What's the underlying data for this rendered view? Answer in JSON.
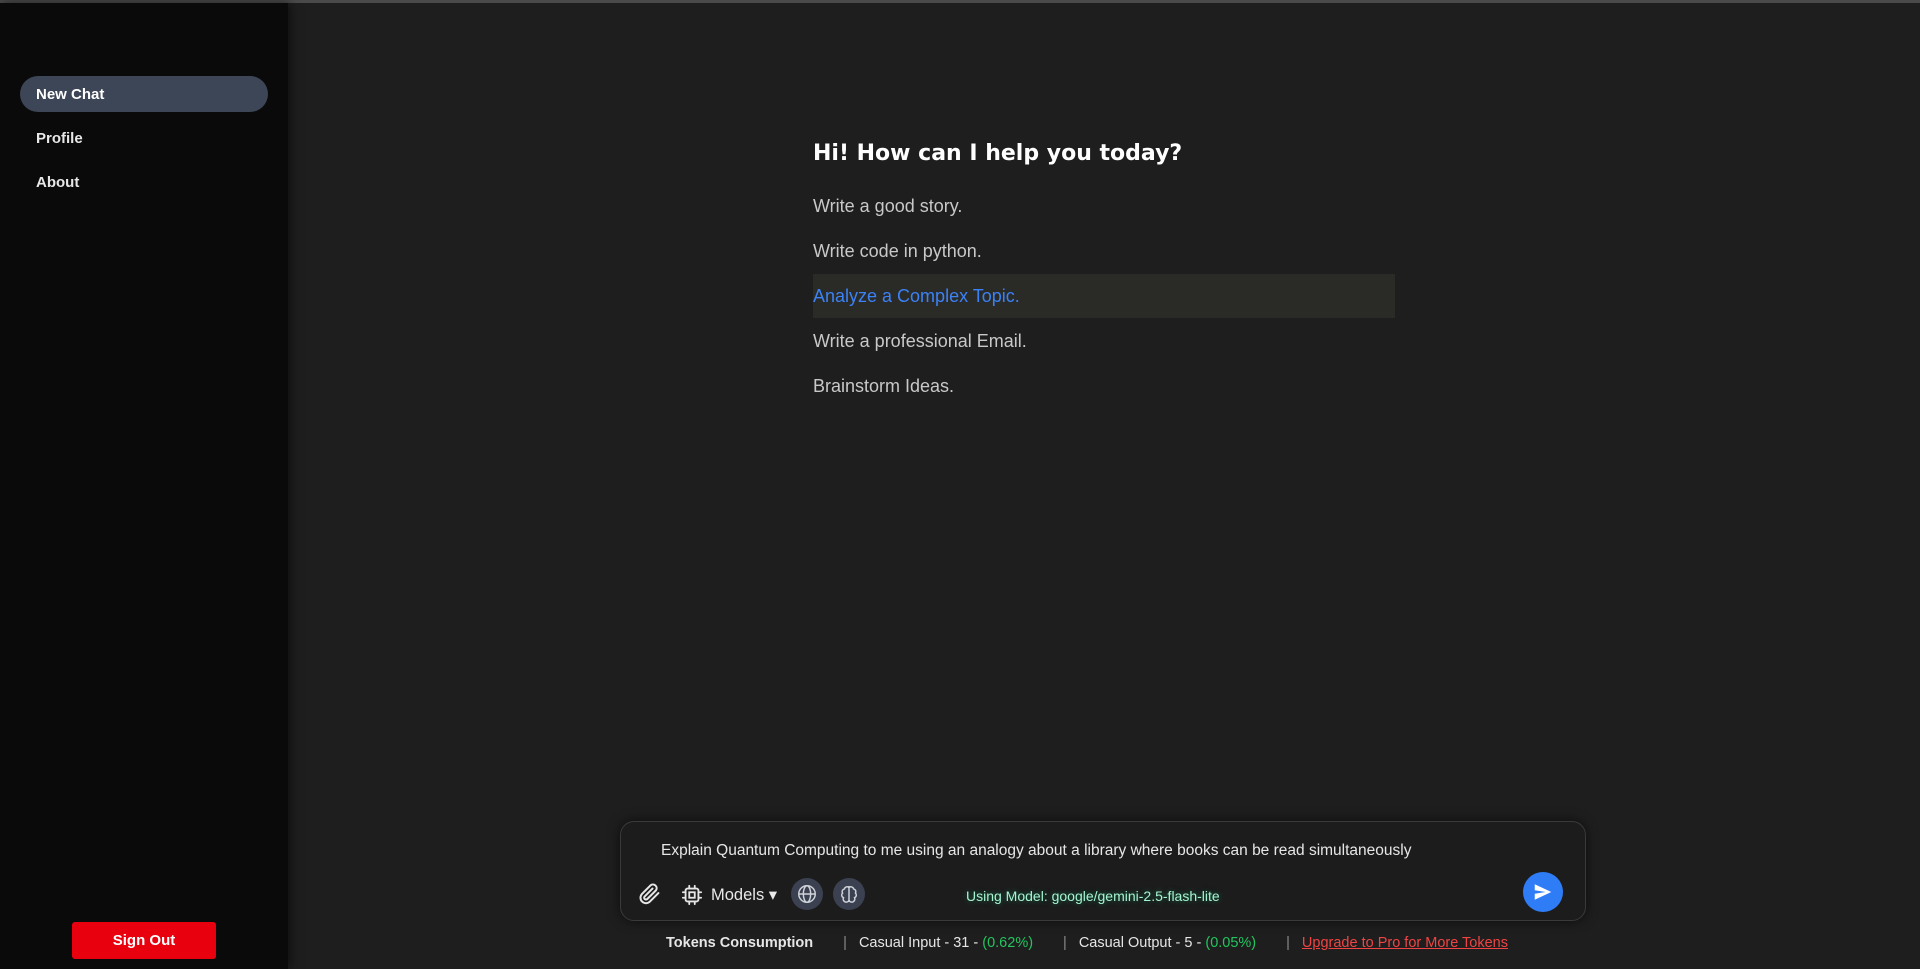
{
  "sidebar": {
    "items": [
      {
        "label": "New Chat",
        "active": true
      },
      {
        "label": "Profile",
        "active": false
      },
      {
        "label": "About",
        "active": false
      }
    ],
    "sign_out_label": "Sign Out"
  },
  "main": {
    "greeting": "Hi! How can I help you today?",
    "suggestions": [
      "Write a good story.",
      "Write code in python.",
      "Analyze a Complex Topic.",
      "Write a professional Email.",
      "Brainstorm Ideas."
    ]
  },
  "composer": {
    "input_value": "Explain Quantum Computing to me using an analogy about a library where books can be read simultaneously",
    "models_label": "Models ▾",
    "model_info": "Using Model: google/gemini-2.5-flash-lite",
    "icons": [
      "paperclip-icon",
      "chip-icon",
      "globe-icon",
      "brain-icon",
      "send-icon"
    ]
  },
  "tokens": {
    "title": "Tokens Consumption",
    "input_label": "Casual Input - 31 - ",
    "input_pct": "(0.62%)",
    "output_label": "Casual Output - 5 - ",
    "output_pct": "(0.05%)",
    "upgrade_label": "Upgrade to Pro for More Tokens"
  },
  "colors": {
    "accent": "#2f7df6",
    "highlight_text": "#3b82f6",
    "sign_out": "#e8000f",
    "percent": "#22c55e",
    "upgrade_link": "#ef4444"
  }
}
